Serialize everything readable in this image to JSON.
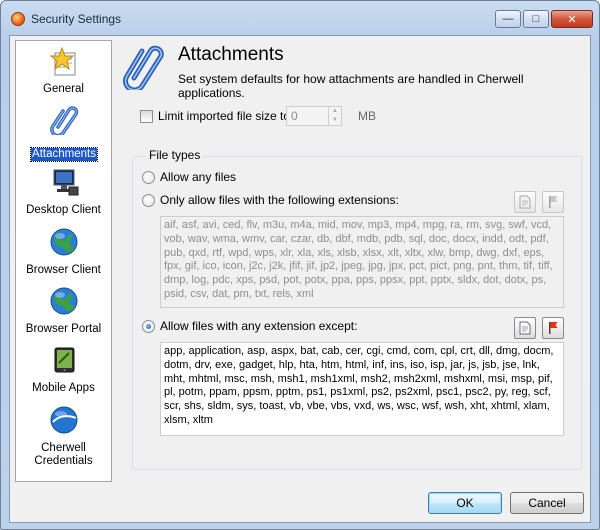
{
  "window": {
    "title": "Security Settings",
    "min_label": "—",
    "max_label": "□",
    "close_label": "✕"
  },
  "sidebar": {
    "items": [
      {
        "label": "General",
        "icon": "star-document-icon"
      },
      {
        "label": "Attachments",
        "icon": "paperclip-icon",
        "selected": true
      },
      {
        "label": "Desktop Client",
        "icon": "computer-icon"
      },
      {
        "label": "Browser Client",
        "icon": "globe-icon"
      },
      {
        "label": "Browser Portal",
        "icon": "globe-icon"
      },
      {
        "label": "Mobile Apps",
        "icon": "tablet-icon"
      },
      {
        "label": "Cherwell Credentials",
        "icon": "cherwell-globe-icon"
      }
    ]
  },
  "header": {
    "title": "Attachments",
    "description": "Set system defaults for how attachments are handled in Cherwell applications."
  },
  "limit": {
    "label": "Limit imported file size to",
    "checked": false,
    "value": "0",
    "unit": "MB"
  },
  "file_types": {
    "group_title": "File types",
    "allow_any_label": "Allow any files",
    "only_allow_label": "Only allow files with the following extensions:",
    "only_allow_list": "aif, asf, avi, ced, flv, m3u, m4a, mid, mov, mp3, mp4, mpg, ra, rm, svg, swf, vcd, vob, wav, wma, wmv, car, czar, db, dbf, mdb, pdb, sql, doc, docx, indd, odt, pdf, pub, qxd, rtf, wpd, wps, xlr, xla, xls, xlsb, xlsx, xlt, xltx, xlw, bmp, dwg, dxf, eps, fpx, gif, ico, icon, j2c, j2k, jfif, jif, jp2, jpeg, jpg, jpx, pct, pict, png, pnt, thm, tif, tiff, dmp, log, pdc, xps, psd, pot, potx, ppa, pps, ppsx, ppt, pptx, sldx, dot, dotx, ps, psid, csv, dat, pm, txt, rels, xml",
    "allow_except_label": "Allow files with any extension except:",
    "allow_except_list": "app, application, asp, aspx, bat, cab, cer, cgi, cmd, com, cpl, crt, dll, dmg, docm, dotm, drv, exe, gadget, hlp, hta, htm, html, inf, ins, iso, isp, jar, js, jsb, jse, lnk, mht, mhtml, msc, msh, msh1, msh1xml, msh2, msh2xml, mshxml, msi, msp, pif, pl, potm, ppam, ppsm, pptm, ps1, ps1xml, ps2, ps2xml, psc1, psc2, py, reg, scf, scr, shs, sldm, sys, toast, vb, vbe, vbs, vxd, ws, wsc, wsf, wsh, xht, xhtml, xlam, xlsm, xltm",
    "selected": "allow_except"
  },
  "buttons": {
    "ok": "OK",
    "cancel": "Cancel"
  }
}
